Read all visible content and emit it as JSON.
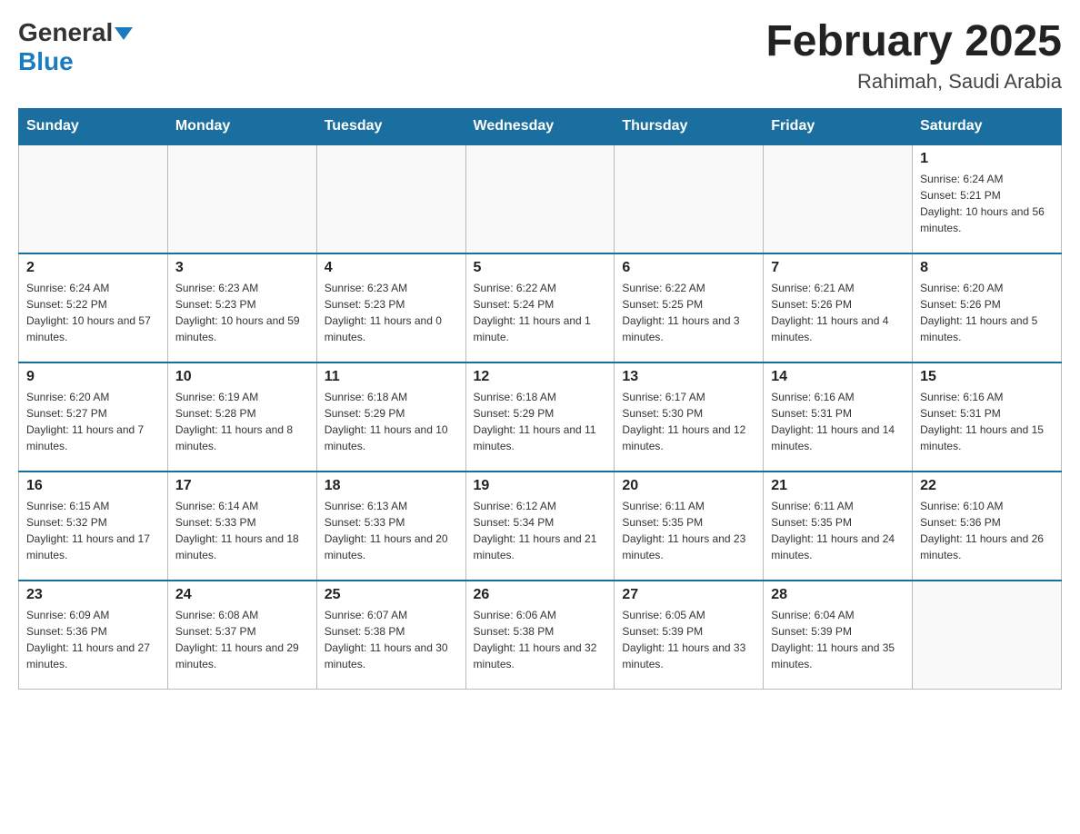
{
  "logo": {
    "general": "General",
    "blue": "Blue"
  },
  "header": {
    "title": "February 2025",
    "location": "Rahimah, Saudi Arabia"
  },
  "days_of_week": [
    "Sunday",
    "Monday",
    "Tuesday",
    "Wednesday",
    "Thursday",
    "Friday",
    "Saturday"
  ],
  "weeks": [
    [
      {
        "day": "",
        "info": ""
      },
      {
        "day": "",
        "info": ""
      },
      {
        "day": "",
        "info": ""
      },
      {
        "day": "",
        "info": ""
      },
      {
        "day": "",
        "info": ""
      },
      {
        "day": "",
        "info": ""
      },
      {
        "day": "1",
        "info": "Sunrise: 6:24 AM\nSunset: 5:21 PM\nDaylight: 10 hours and 56 minutes."
      }
    ],
    [
      {
        "day": "2",
        "info": "Sunrise: 6:24 AM\nSunset: 5:22 PM\nDaylight: 10 hours and 57 minutes."
      },
      {
        "day": "3",
        "info": "Sunrise: 6:23 AM\nSunset: 5:23 PM\nDaylight: 10 hours and 59 minutes."
      },
      {
        "day": "4",
        "info": "Sunrise: 6:23 AM\nSunset: 5:23 PM\nDaylight: 11 hours and 0 minutes."
      },
      {
        "day": "5",
        "info": "Sunrise: 6:22 AM\nSunset: 5:24 PM\nDaylight: 11 hours and 1 minute."
      },
      {
        "day": "6",
        "info": "Sunrise: 6:22 AM\nSunset: 5:25 PM\nDaylight: 11 hours and 3 minutes."
      },
      {
        "day": "7",
        "info": "Sunrise: 6:21 AM\nSunset: 5:26 PM\nDaylight: 11 hours and 4 minutes."
      },
      {
        "day": "8",
        "info": "Sunrise: 6:20 AM\nSunset: 5:26 PM\nDaylight: 11 hours and 5 minutes."
      }
    ],
    [
      {
        "day": "9",
        "info": "Sunrise: 6:20 AM\nSunset: 5:27 PM\nDaylight: 11 hours and 7 minutes."
      },
      {
        "day": "10",
        "info": "Sunrise: 6:19 AM\nSunset: 5:28 PM\nDaylight: 11 hours and 8 minutes."
      },
      {
        "day": "11",
        "info": "Sunrise: 6:18 AM\nSunset: 5:29 PM\nDaylight: 11 hours and 10 minutes."
      },
      {
        "day": "12",
        "info": "Sunrise: 6:18 AM\nSunset: 5:29 PM\nDaylight: 11 hours and 11 minutes."
      },
      {
        "day": "13",
        "info": "Sunrise: 6:17 AM\nSunset: 5:30 PM\nDaylight: 11 hours and 12 minutes."
      },
      {
        "day": "14",
        "info": "Sunrise: 6:16 AM\nSunset: 5:31 PM\nDaylight: 11 hours and 14 minutes."
      },
      {
        "day": "15",
        "info": "Sunrise: 6:16 AM\nSunset: 5:31 PM\nDaylight: 11 hours and 15 minutes."
      }
    ],
    [
      {
        "day": "16",
        "info": "Sunrise: 6:15 AM\nSunset: 5:32 PM\nDaylight: 11 hours and 17 minutes."
      },
      {
        "day": "17",
        "info": "Sunrise: 6:14 AM\nSunset: 5:33 PM\nDaylight: 11 hours and 18 minutes."
      },
      {
        "day": "18",
        "info": "Sunrise: 6:13 AM\nSunset: 5:33 PM\nDaylight: 11 hours and 20 minutes."
      },
      {
        "day": "19",
        "info": "Sunrise: 6:12 AM\nSunset: 5:34 PM\nDaylight: 11 hours and 21 minutes."
      },
      {
        "day": "20",
        "info": "Sunrise: 6:11 AM\nSunset: 5:35 PM\nDaylight: 11 hours and 23 minutes."
      },
      {
        "day": "21",
        "info": "Sunrise: 6:11 AM\nSunset: 5:35 PM\nDaylight: 11 hours and 24 minutes."
      },
      {
        "day": "22",
        "info": "Sunrise: 6:10 AM\nSunset: 5:36 PM\nDaylight: 11 hours and 26 minutes."
      }
    ],
    [
      {
        "day": "23",
        "info": "Sunrise: 6:09 AM\nSunset: 5:36 PM\nDaylight: 11 hours and 27 minutes."
      },
      {
        "day": "24",
        "info": "Sunrise: 6:08 AM\nSunset: 5:37 PM\nDaylight: 11 hours and 29 minutes."
      },
      {
        "day": "25",
        "info": "Sunrise: 6:07 AM\nSunset: 5:38 PM\nDaylight: 11 hours and 30 minutes."
      },
      {
        "day": "26",
        "info": "Sunrise: 6:06 AM\nSunset: 5:38 PM\nDaylight: 11 hours and 32 minutes."
      },
      {
        "day": "27",
        "info": "Sunrise: 6:05 AM\nSunset: 5:39 PM\nDaylight: 11 hours and 33 minutes."
      },
      {
        "day": "28",
        "info": "Sunrise: 6:04 AM\nSunset: 5:39 PM\nDaylight: 11 hours and 35 minutes."
      },
      {
        "day": "",
        "info": ""
      }
    ]
  ]
}
